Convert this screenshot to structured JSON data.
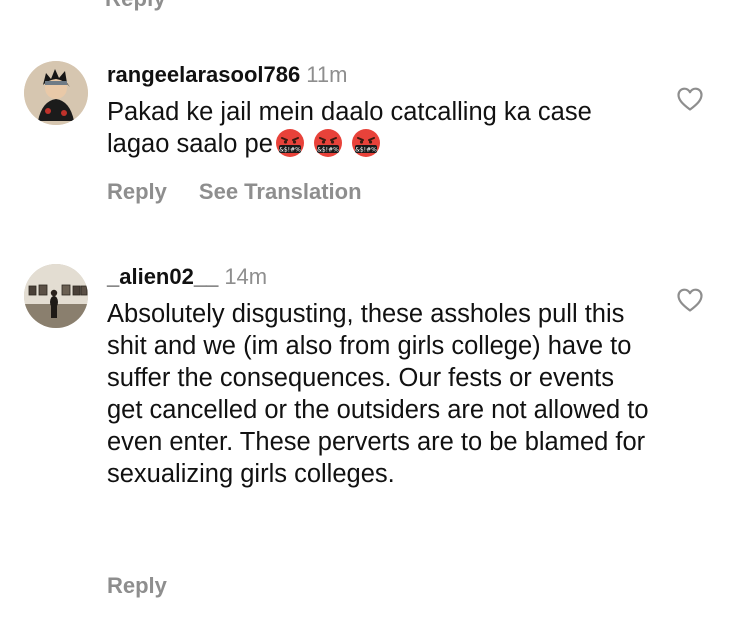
{
  "previous_comment": {
    "reply_label": "Reply"
  },
  "comments": [
    {
      "username": "rangeelarasool786",
      "time": "11m",
      "text": "Pakad ke jail mein daalo catcalling ka case lagao saalo pe",
      "emojis": [
        "face-with-symbols-on-mouth",
        "face-with-symbols-on-mouth",
        "face-with-symbols-on-mouth"
      ],
      "reply_label": "Reply",
      "translate_label": "See Translation",
      "like_icon": "heart-outline-icon"
    },
    {
      "username": "_alien02__",
      "time": "14m",
      "text": "Absolutely disgusting, these assholes pull this shit and we (im also from girls college) have to suffer the consequences. Our fests or events get cancelled or the outsiders are not allowed to even enter. These perverts are to be blamed for sexualizing girls colleges.",
      "reply_label": "Reply",
      "like_icon": "heart-outline-icon"
    }
  ],
  "colors": {
    "primary_text": "#111111",
    "secondary_text": "#8e8e8e",
    "emoji_face": "#e8423a",
    "background": "#ffffff"
  }
}
